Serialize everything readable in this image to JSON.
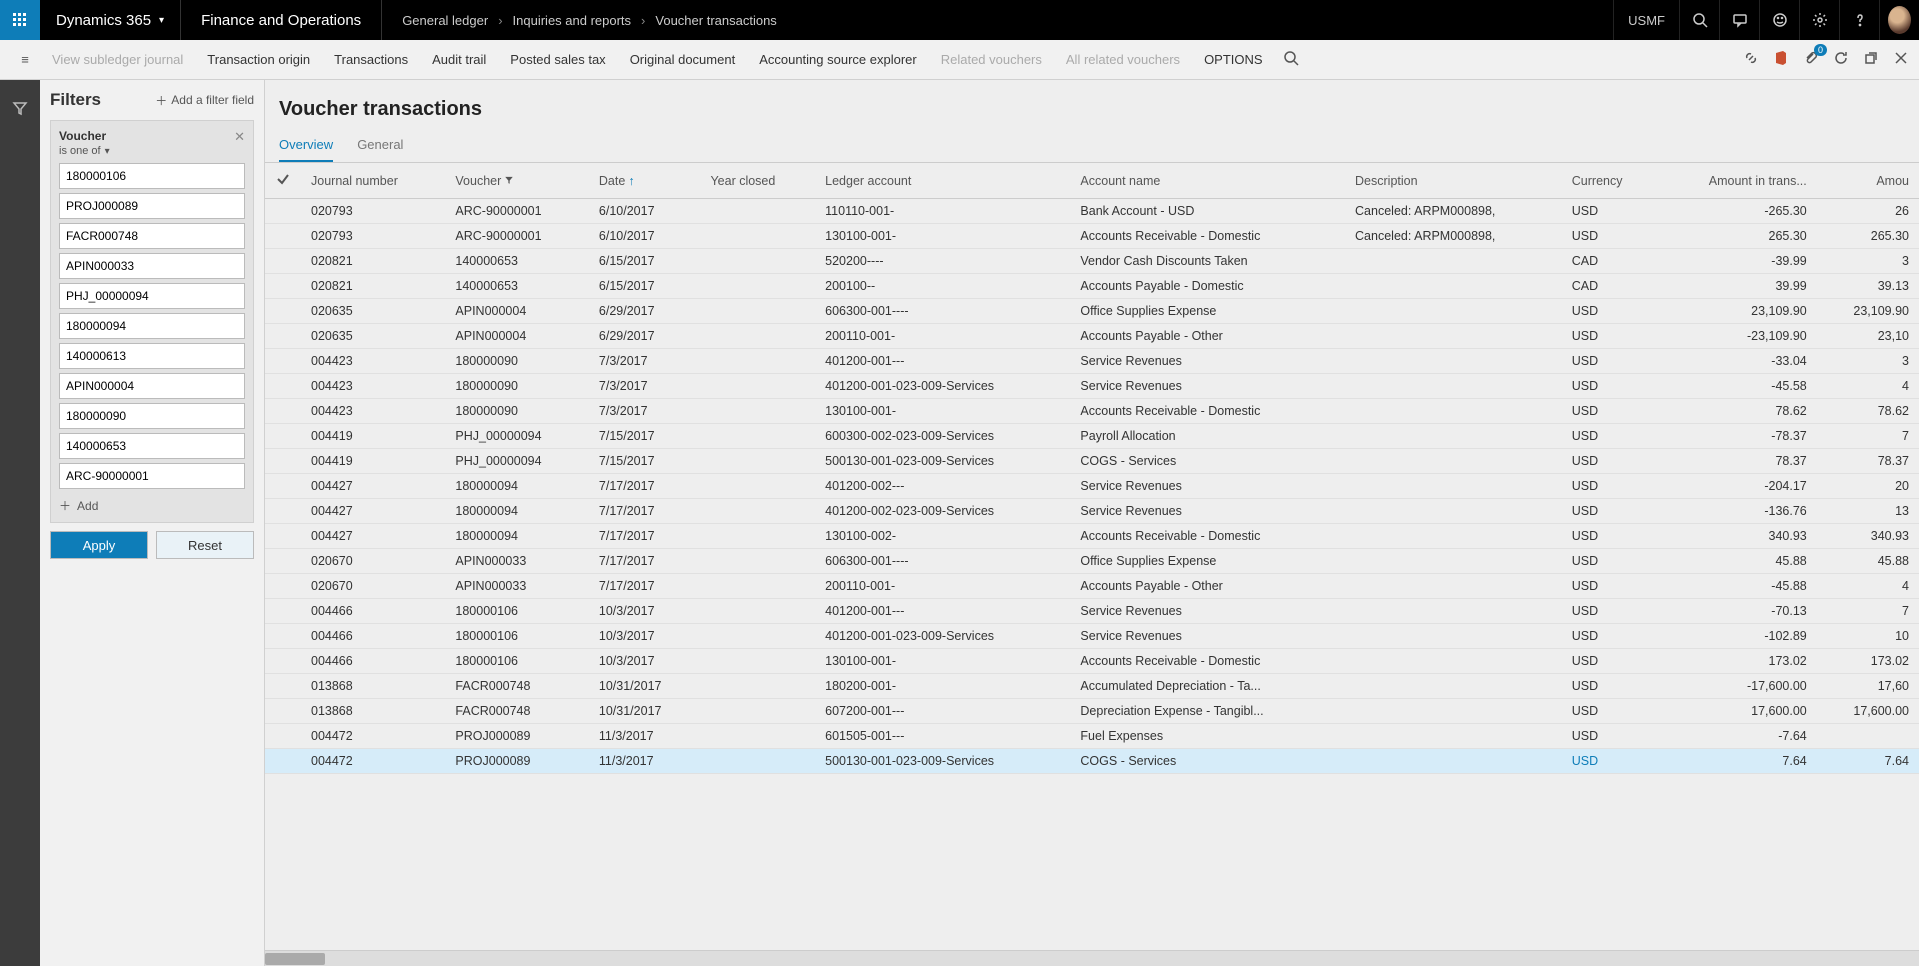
{
  "topbar": {
    "brand": "Dynamics 365",
    "module": "Finance and Operations",
    "breadcrumbs": [
      "General ledger",
      "Inquiries and reports",
      "Voucher transactions"
    ],
    "company": "USMF"
  },
  "actionbar": {
    "items": [
      {
        "label": "View subledger journal",
        "disabled": true
      },
      {
        "label": "Transaction origin"
      },
      {
        "label": "Transactions"
      },
      {
        "label": "Audit trail"
      },
      {
        "label": "Posted sales tax"
      },
      {
        "label": "Original document"
      },
      {
        "label": "Accounting source explorer"
      },
      {
        "label": "Related vouchers",
        "disabled": true
      },
      {
        "label": "All related vouchers",
        "disabled": true
      },
      {
        "label": "OPTIONS"
      }
    ],
    "badge_count": "0"
  },
  "filters": {
    "title": "Filters",
    "add_field": "Add a filter field",
    "card": {
      "title": "Voucher",
      "operator": "is one of",
      "values": [
        "180000106",
        "PROJ000089",
        "FACR000748",
        "APIN000033",
        "PHJ_00000094",
        "180000094",
        "140000613",
        "APIN000004",
        "180000090",
        "140000653",
        "ARC-90000001"
      ],
      "add": "Add"
    },
    "apply": "Apply",
    "reset": "Reset"
  },
  "page": {
    "title": "Voucher transactions",
    "tabs": [
      {
        "label": "Overview",
        "active": true
      },
      {
        "label": "General"
      }
    ]
  },
  "grid": {
    "columns": [
      "Journal number",
      "Voucher",
      "Date",
      "Year closed",
      "Ledger account",
      "Account name",
      "Description",
      "Currency",
      "Amount in trans...",
      "Amou"
    ],
    "sort_col": "Date",
    "filter_col": "Voucher",
    "rows": [
      {
        "jn": "020793",
        "v": "ARC-90000001",
        "d": "6/10/2017",
        "yc": "",
        "la": "110110-001-",
        "an": "Bank Account - USD",
        "desc": "Canceled: ARPM000898,",
        "cur": "USD",
        "a1": "-265.30",
        "a2": "26"
      },
      {
        "jn": "020793",
        "v": "ARC-90000001",
        "d": "6/10/2017",
        "yc": "",
        "la": "130100-001-",
        "an": "Accounts Receivable - Domestic",
        "desc": "Canceled: ARPM000898,",
        "cur": "USD",
        "a1": "265.30",
        "a2": "265.30"
      },
      {
        "jn": "020821",
        "v": "140000653",
        "d": "6/15/2017",
        "yc": "",
        "la": "520200----",
        "an": "Vendor Cash Discounts Taken",
        "desc": "",
        "cur": "CAD",
        "a1": "-39.99",
        "a2": "3"
      },
      {
        "jn": "020821",
        "v": "140000653",
        "d": "6/15/2017",
        "yc": "",
        "la": "200100--",
        "an": "Accounts Payable - Domestic",
        "desc": "",
        "cur": "CAD",
        "a1": "39.99",
        "a2": "39.13"
      },
      {
        "jn": "020635",
        "v": "APIN000004",
        "d": "6/29/2017",
        "yc": "",
        "la": "606300-001----",
        "an": "Office Supplies Expense",
        "desc": "",
        "cur": "USD",
        "a1": "23,109.90",
        "a2": "23,109.90"
      },
      {
        "jn": "020635",
        "v": "APIN000004",
        "d": "6/29/2017",
        "yc": "",
        "la": "200110-001-",
        "an": "Accounts Payable - Other",
        "desc": "",
        "cur": "USD",
        "a1": "-23,109.90",
        "a2": "23,10"
      },
      {
        "jn": "004423",
        "v": "180000090",
        "d": "7/3/2017",
        "yc": "",
        "la": "401200-001---",
        "an": "Service Revenues",
        "desc": "",
        "cur": "USD",
        "a1": "-33.04",
        "a2": "3"
      },
      {
        "jn": "004423",
        "v": "180000090",
        "d": "7/3/2017",
        "yc": "",
        "la": "401200-001-023-009-Services",
        "an": "Service Revenues",
        "desc": "",
        "cur": "USD",
        "a1": "-45.58",
        "a2": "4"
      },
      {
        "jn": "004423",
        "v": "180000090",
        "d": "7/3/2017",
        "yc": "",
        "la": "130100-001-",
        "an": "Accounts Receivable - Domestic",
        "desc": "",
        "cur": "USD",
        "a1": "78.62",
        "a2": "78.62"
      },
      {
        "jn": "004419",
        "v": "PHJ_00000094",
        "d": "7/15/2017",
        "yc": "",
        "la": "600300-002-023-009-Services",
        "an": "Payroll Allocation",
        "desc": "",
        "cur": "USD",
        "a1": "-78.37",
        "a2": "7"
      },
      {
        "jn": "004419",
        "v": "PHJ_00000094",
        "d": "7/15/2017",
        "yc": "",
        "la": "500130-001-023-009-Services",
        "an": "COGS - Services",
        "desc": "",
        "cur": "USD",
        "a1": "78.37",
        "a2": "78.37"
      },
      {
        "jn": "004427",
        "v": "180000094",
        "d": "7/17/2017",
        "yc": "",
        "la": "401200-002---",
        "an": "Service Revenues",
        "desc": "",
        "cur": "USD",
        "a1": "-204.17",
        "a2": "20"
      },
      {
        "jn": "004427",
        "v": "180000094",
        "d": "7/17/2017",
        "yc": "",
        "la": "401200-002-023-009-Services",
        "an": "Service Revenues",
        "desc": "",
        "cur": "USD",
        "a1": "-136.76",
        "a2": "13"
      },
      {
        "jn": "004427",
        "v": "180000094",
        "d": "7/17/2017",
        "yc": "",
        "la": "130100-002-",
        "an": "Accounts Receivable - Domestic",
        "desc": "",
        "cur": "USD",
        "a1": "340.93",
        "a2": "340.93"
      },
      {
        "jn": "020670",
        "v": "APIN000033",
        "d": "7/17/2017",
        "yc": "",
        "la": "606300-001----",
        "an": "Office Supplies Expense",
        "desc": "",
        "cur": "USD",
        "a1": "45.88",
        "a2": "45.88"
      },
      {
        "jn": "020670",
        "v": "APIN000033",
        "d": "7/17/2017",
        "yc": "",
        "la": "200110-001-",
        "an": "Accounts Payable - Other",
        "desc": "",
        "cur": "USD",
        "a1": "-45.88",
        "a2": "4"
      },
      {
        "jn": "004466",
        "v": "180000106",
        "d": "10/3/2017",
        "yc": "",
        "la": "401200-001---",
        "an": "Service Revenues",
        "desc": "",
        "cur": "USD",
        "a1": "-70.13",
        "a2": "7"
      },
      {
        "jn": "004466",
        "v": "180000106",
        "d": "10/3/2017",
        "yc": "",
        "la": "401200-001-023-009-Services",
        "an": "Service Revenues",
        "desc": "",
        "cur": "USD",
        "a1": "-102.89",
        "a2": "10"
      },
      {
        "jn": "004466",
        "v": "180000106",
        "d": "10/3/2017",
        "yc": "",
        "la": "130100-001-",
        "an": "Accounts Receivable - Domestic",
        "desc": "",
        "cur": "USD",
        "a1": "173.02",
        "a2": "173.02"
      },
      {
        "jn": "013868",
        "v": "FACR000748",
        "d": "10/31/2017",
        "yc": "",
        "la": "180200-001-",
        "an": "Accumulated Depreciation - Ta...",
        "desc": "",
        "cur": "USD",
        "a1": "-17,600.00",
        "a2": "17,60"
      },
      {
        "jn": "013868",
        "v": "FACR000748",
        "d": "10/31/2017",
        "yc": "",
        "la": "607200-001---",
        "an": "Depreciation Expense - Tangibl...",
        "desc": "",
        "cur": "USD",
        "a1": "17,600.00",
        "a2": "17,600.00"
      },
      {
        "jn": "004472",
        "v": "PROJ000089",
        "d": "11/3/2017",
        "yc": "",
        "la": "601505-001---",
        "an": "Fuel Expenses",
        "desc": "",
        "cur": "USD",
        "a1": "-7.64",
        "a2": ""
      },
      {
        "jn": "004472",
        "v": "PROJ000089",
        "d": "11/3/2017",
        "yc": "",
        "la": "500130-001-023-009-Services",
        "an": "COGS - Services",
        "desc": "",
        "cur": "USD",
        "a1": "7.64",
        "a2": "7.64",
        "selected": true
      }
    ]
  }
}
